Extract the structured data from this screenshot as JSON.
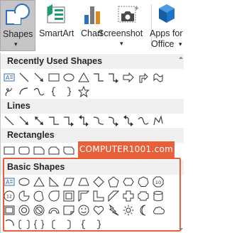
{
  "ribbon": {
    "shapes_label": "Shapes",
    "smartart_label": "SmartArt",
    "chart_label": "Chart",
    "screenshot_label": "Screenshot",
    "apps_label_1": "Apps for",
    "apps_label_2": "Office"
  },
  "gallery": {
    "recent_header": "Recently Used Shapes",
    "lines_header": "Lines",
    "rectangles_header": "Rectangles",
    "basic_header": "Basic Shapes"
  },
  "watermark": "COMPUTER1001.com",
  "colors": {
    "accent": "#e8603a",
    "header_bg": "#f0f0f0",
    "shapes_button_bg": "#c5c5c5",
    "icon_blue": "#2b6fbf"
  }
}
